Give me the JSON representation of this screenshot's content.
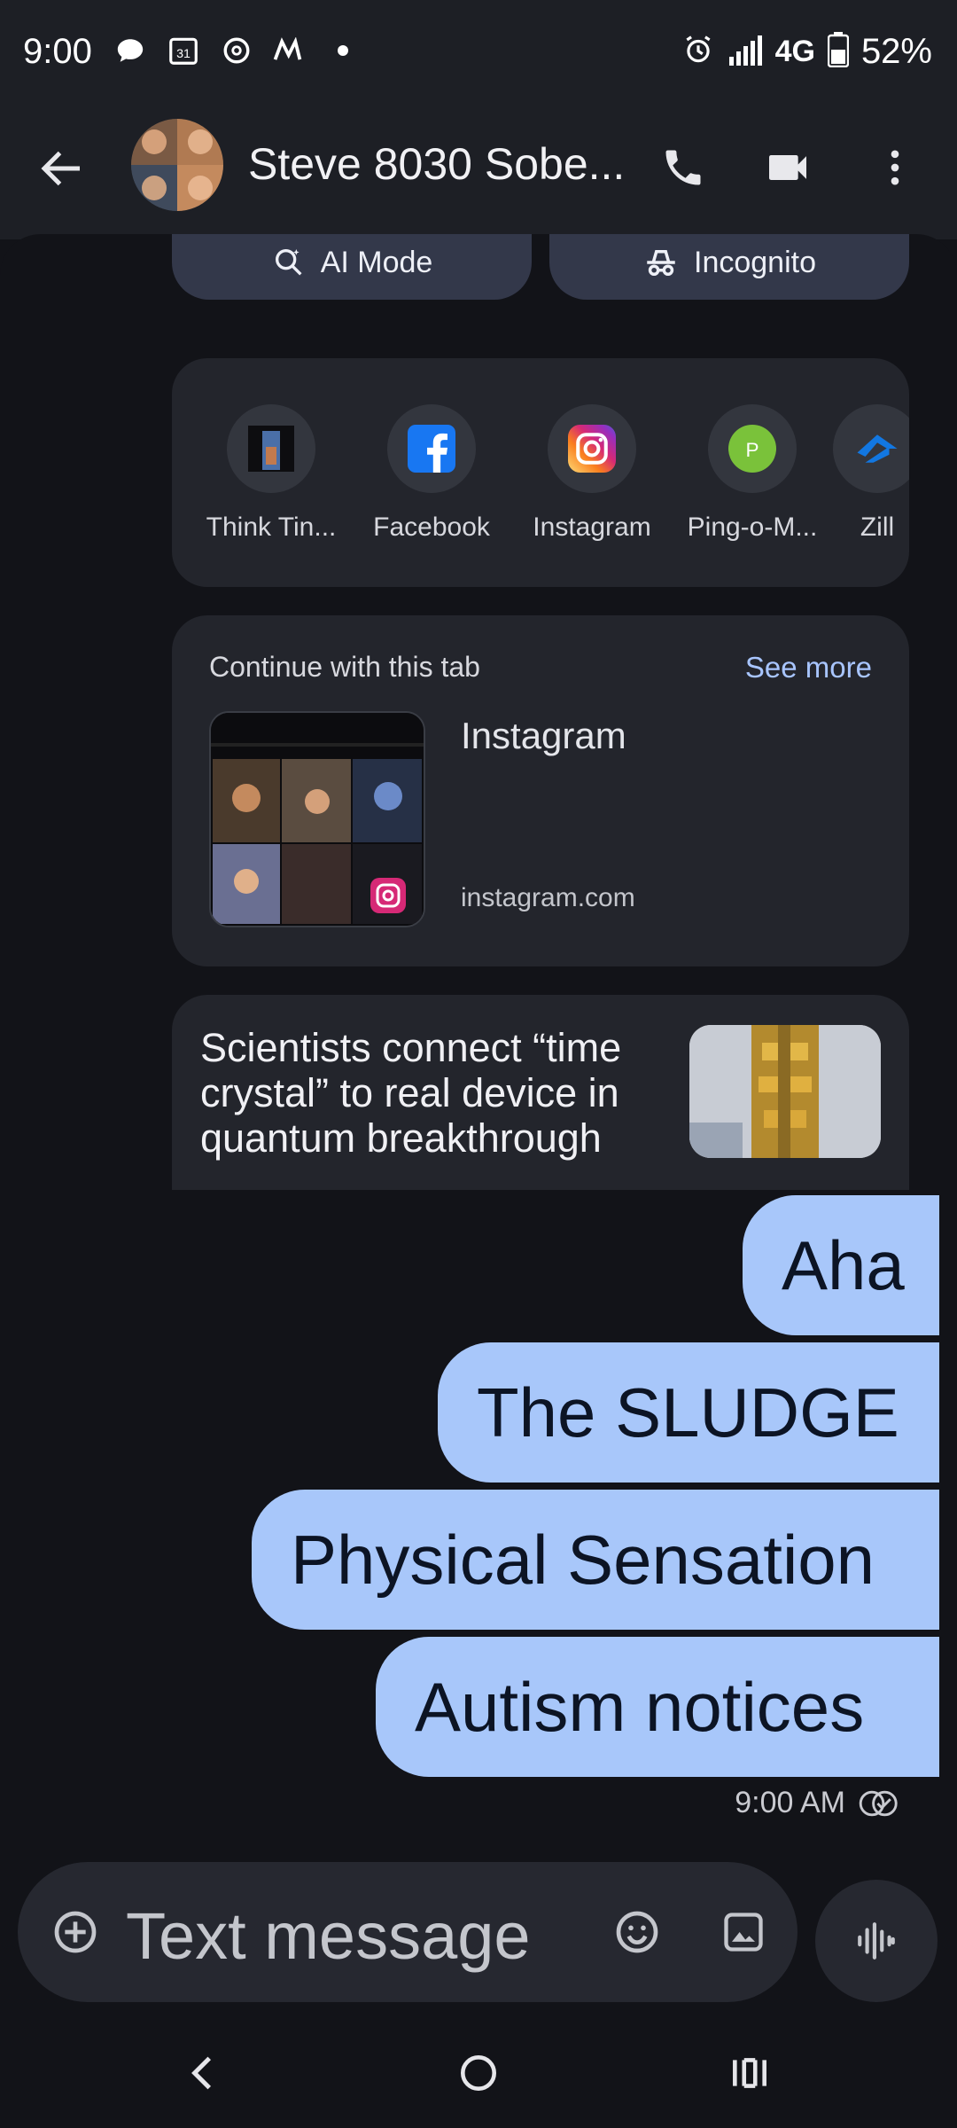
{
  "status_bar": {
    "time": "9:00",
    "calendar_day": "31",
    "network": "4G",
    "battery": "52%"
  },
  "header": {
    "contact_name": "Steve 8030 Sobe...",
    "icons": [
      "back-arrow-icon",
      "phone-icon",
      "video-icon",
      "more-vert-icon"
    ]
  },
  "search_modes": {
    "ai_mode": "AI Mode",
    "incognito": "Incognito"
  },
  "shortcuts": [
    {
      "label": "Think Tin...",
      "icon": "think-tank-icon"
    },
    {
      "label": "Facebook",
      "icon": "facebook-icon"
    },
    {
      "label": "Instagram",
      "icon": "instagram-icon"
    },
    {
      "label": "Ping-o-M...",
      "icon": "ping-icon",
      "letter": "P"
    },
    {
      "label": "Zill",
      "icon": "zillow-icon"
    }
  ],
  "continue_tab": {
    "title": "Continue with this tab",
    "see_more": "See more",
    "site_name": "Instagram",
    "site_url": "instagram.com"
  },
  "news": {
    "headline": "Scientists connect “time crystal” to real device in quantum breakthrough"
  },
  "messages": [
    "Aha",
    "The SLUDGE",
    "Physical Sensation",
    "Autism notices"
  ],
  "message_time": "9:00 AM",
  "composer": {
    "placeholder": "Text message"
  },
  "colors": {
    "bubble": "#a8c7fa",
    "background": "#121318",
    "link": "#a8c5ff"
  }
}
